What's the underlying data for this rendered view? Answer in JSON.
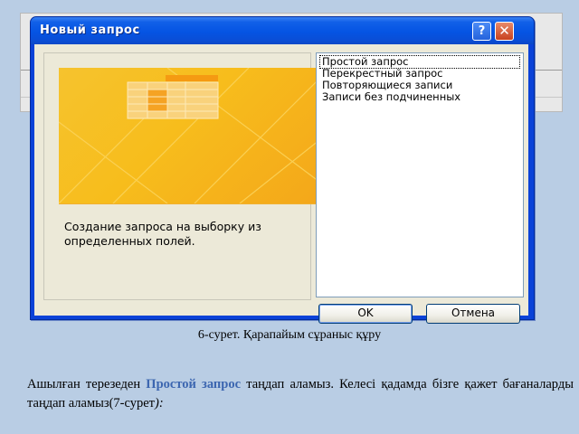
{
  "dialog": {
    "title": "Новый запрос",
    "help_glyph": "?",
    "close_glyph": "✕",
    "description": "Создание запроса на выборку из определенных полей.",
    "list_items": [
      {
        "label": "Простой запрос",
        "selected": true
      },
      {
        "label": "Перекрестный запрос",
        "selected": false
      },
      {
        "label": "Повторяющиеся записи",
        "selected": false
      },
      {
        "label": "Записи без подчиненных",
        "selected": false
      }
    ],
    "ok_label": "OK",
    "cancel_label": "Отмена"
  },
  "caption": "6-сурет. Қарапайым сұраныс құру",
  "paragraph": {
    "before": "Ашылған терезеден ",
    "highlight": "Простой запрос",
    "after": " таңдап аламыз. Келесі қадамда бізге қажет бағаналарды таңдап аламыз(7-сурет",
    "end": "):"
  },
  "colors": {
    "title_bar": "#0554e3",
    "dialog_face": "#ece9d8",
    "preview_yellow": "#f7bd1c",
    "highlight_text": "#3c66b0"
  }
}
